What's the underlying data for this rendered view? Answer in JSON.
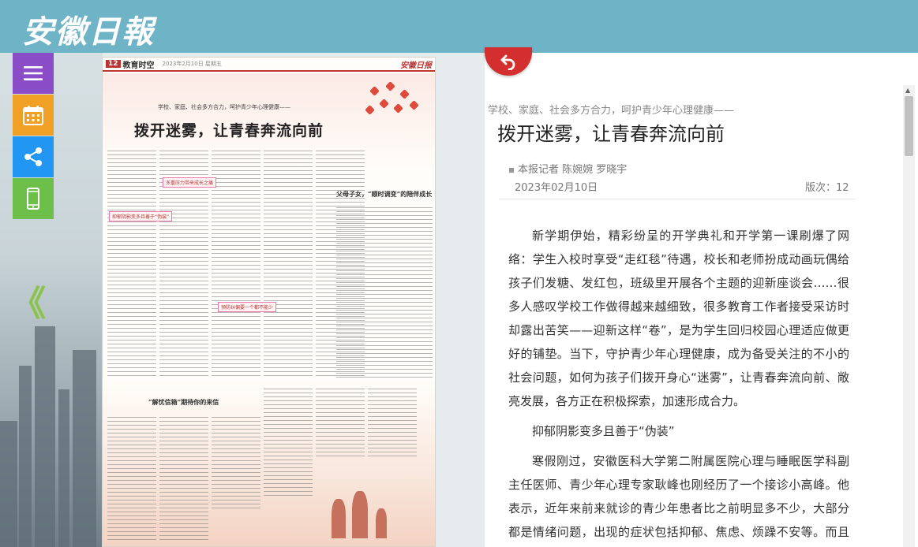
{
  "header": {
    "logo_text": "安徽日報"
  },
  "sidenav": [
    {
      "name": "menu-button",
      "icon": "hamburger-icon",
      "color": "#8b4cc8"
    },
    {
      "name": "calendar-button",
      "icon": "calendar-icon",
      "color": "#f0a025"
    },
    {
      "name": "share-button",
      "icon": "share-icon",
      "color": "#2196f3"
    },
    {
      "name": "mobile-button",
      "icon": "mobile-icon",
      "color": "#6cc04a"
    }
  ],
  "back_arrow": "《",
  "paper": {
    "page_num": "12",
    "section": "教育时空",
    "date_line": "2023年2月10日 星期五",
    "brand": "安徽日报",
    "subtitle": "学校、家庭、社会多方合力，呵护青少年心理健康——",
    "title": "拨开迷雾，让青春奔流向前",
    "box1": "父母子女，“顺时调变”的陪伴成长",
    "box2": "“解忧信箱”期待你的来信",
    "heads": [
      "多重压力带来成长之痛",
      "抑郁阴影变多且善于“伪装”",
      "预防纠偏要一个都不能少"
    ]
  },
  "article": {
    "subtitle": "学校、家庭、社会多方合力，呵护青少年心理健康——",
    "title": "拨开迷雾，让青春奔流向前",
    "author": "本报记者 陈婉婉 罗晓宇",
    "date": "2023年02月10日",
    "page": "版次：12",
    "paragraphs": [
      "新学期伊始，精彩纷呈的开学典礼和开学第一课刷爆了网络：学生入校时享受“走红毯”待遇，校长和老师扮成动画玩偶给孩子们发糖、发红包，班级里开展各个主题的迎新座谈会……很多人感叹学校工作做得越来越细致，很多教育工作者接受采访时却露出苦笑——迎新这样“卷”，是为学生回归校园心理适应做更好的铺垫。当下，守护青少年心理健康，成为备受关注的不小的社会问题，如何为孩子们拨开身心“迷雾”，让青春奔流向前、敞亮发展，各方正在积极探索，加速形成合力。",
      "抑郁阴影变多且善于“伪装”",
      "寒假刚过，安徽医科大学第二附属医院心理与睡眠医学科副主任医师、青少年心理专家耿峰也刚经历了一个接诊小高峰。他表示，近年来前来就诊的青少年患者比之前明显多不少，大部分都是情绪问题，出现的症状包括抑郁、焦虑、烦躁不安等。而且患者年龄也出现低龄化趋向：以前这些病症多发在中学、大学阶"
    ]
  }
}
